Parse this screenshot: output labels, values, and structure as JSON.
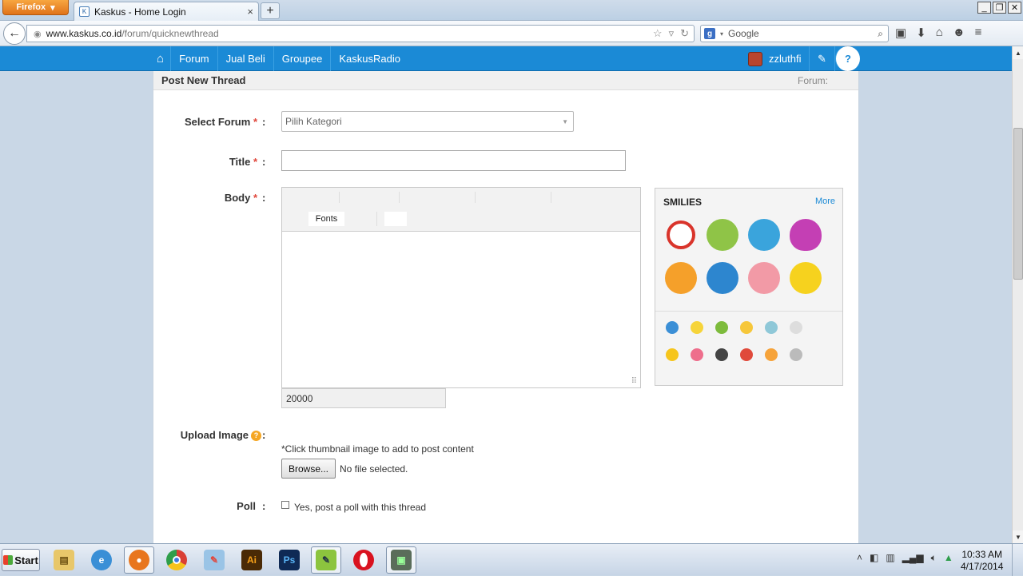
{
  "browser": {
    "app_button": "Firefox",
    "tab_title": "Kaskus - Home Login",
    "url_domain": "www.kaskus.co.id",
    "url_path": "/forum/quicknewthread",
    "search_engine": "Google",
    "search_placeholder": "Google"
  },
  "kaskus_nav": {
    "items": [
      "Forum",
      "Jual Beli",
      "Groupee",
      "KaskusRadio"
    ],
    "username": "zzluthfi"
  },
  "page": {
    "header_title": "Post New Thread",
    "header_forum": "Forum:",
    "select_forum_label": "Select Forum",
    "select_forum_value": "Pilih Kategori",
    "title_label": "Title",
    "body_label": "Body",
    "fonts_label": "Fonts",
    "char_counter": "20000",
    "smilies_title": "SMILIES",
    "smilies_more": "More",
    "upload_label": "Upload Image",
    "upload_hint": "*Click thumbnail image to add to post content",
    "browse_label": "Browse...",
    "no_file": "No file selected.",
    "poll_label": "Poll",
    "poll_checkbox_label": "Yes, post a poll with this thread",
    "required_mark": "*",
    "colon": ":"
  },
  "colors": {
    "kaskus_blue": "#1b8ad6",
    "required_red": "#e0463b",
    "help_orange": "#f5a623"
  },
  "taskbar": {
    "start_label": "Start",
    "clock_time": "10:33 AM",
    "clock_date": "4/17/2014",
    "apps": [
      "explorer-icon",
      "ie-icon",
      "firefox-icon",
      "chrome-icon",
      "paint-icon",
      "illustrator-icon",
      "photoshop-icon",
      "notepad-icon",
      "opera-icon",
      "monitor-icon"
    ]
  }
}
